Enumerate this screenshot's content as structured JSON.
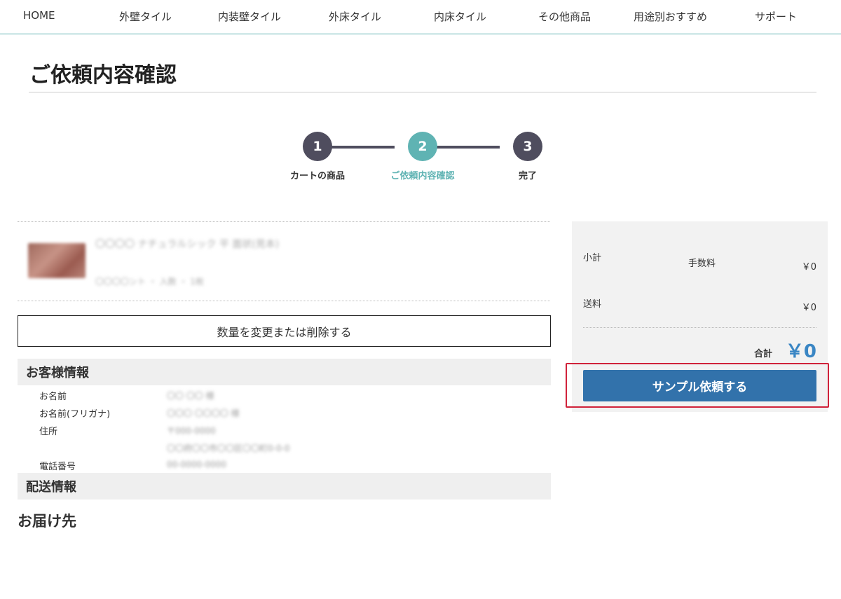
{
  "nav": {
    "items": [
      "HOME",
      "外壁タイル",
      "内装壁タイル",
      "外床タイル",
      "内床タイル",
      "その他商品",
      "用途別おすすめ",
      "サポート"
    ]
  },
  "page": {
    "title": "ご依頼内容確認"
  },
  "steps": [
    {
      "number": "1",
      "label": "カートの商品"
    },
    {
      "number": "2",
      "label": "ご依頼内容確認"
    },
    {
      "number": "3",
      "label": "完了"
    }
  ],
  "cart": {
    "item_name": "〇〇〇〇 ナチュラルシック 平 面状(見本)",
    "item_meta": "〇〇〇〇ント ・ 入数 ・ 1枚",
    "change_button": "数量を変更または削除する"
  },
  "customer": {
    "heading": "お客様情報",
    "rows": [
      {
        "label": "お名前",
        "value": "〇〇 〇〇 様"
      },
      {
        "label": "お名前(フリガナ)",
        "value": "〇〇〇 〇〇〇〇 様"
      },
      {
        "label": "住所",
        "value": "〒000-0000"
      },
      {
        "label": "",
        "value": "〇〇府〇〇市〇〇区〇〇町0-0-0"
      },
      {
        "label": "電話番号",
        "value": "00-0000-0000"
      }
    ]
  },
  "shipping": {
    "heading": "配送情報",
    "sub_heading": "お届け先"
  },
  "summary": {
    "subtotal_label": "小計",
    "fee_label": "手数料",
    "fee_value": "￥0",
    "shipping_label": "送料",
    "shipping_value": "￥0",
    "total_label": "合計",
    "total_value": "￥0",
    "submit_button": "サンプル依頼する"
  },
  "colors": {
    "accent": "#5fb3b3",
    "step_dark": "#4f4d5e",
    "total_blue": "#3a86c4",
    "button_blue": "#3272ab",
    "highlight_red": "#d0223a"
  }
}
